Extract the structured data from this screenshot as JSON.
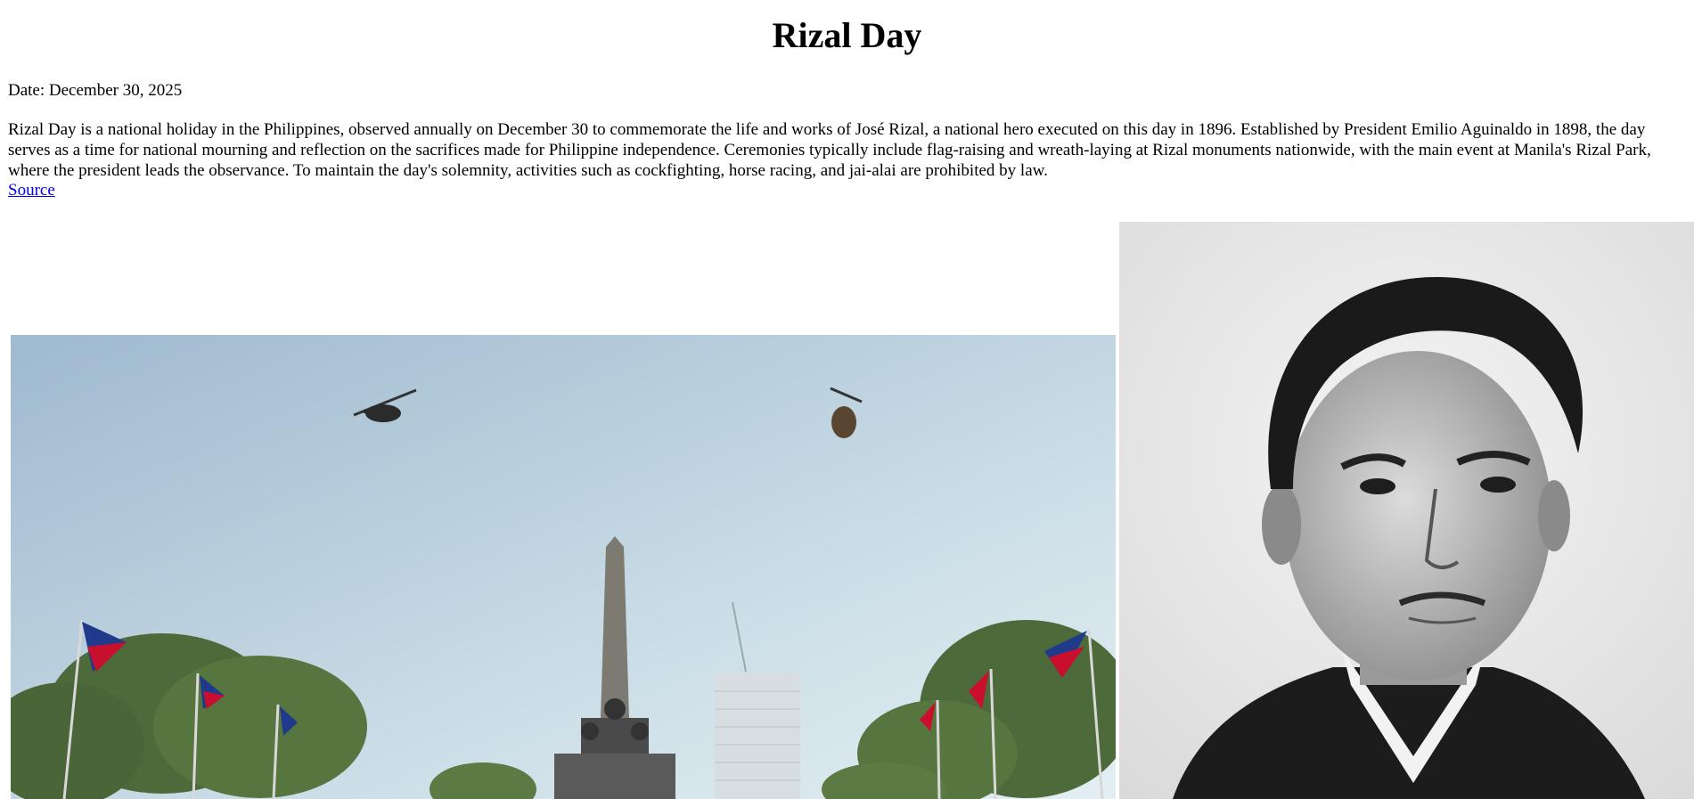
{
  "page": {
    "title": "Rizal Day",
    "date_line": "Date: December 30, 2025",
    "description": "Rizal Day is a national holiday in the Philippines, observed annually on December 30 to commemorate the life and works of José Rizal, a national hero executed on this day in 1896. Established by President Emilio Aguinaldo in 1898, the day serves as a time for national mourning and reflection on the sacrifices made for Philippine independence. Ceremonies typically include flag-raising and wreath-laying at Rizal monuments nationwide, with the main event at Manila's Rizal Park, where the president leads the observance. To maintain the day's solemnity, activities such as cockfighting, horse racing, and jai-alai are prohibited by law.",
    "source_link": "Source"
  },
  "images": {
    "park_photo": {
      "subject": "rizal-monument-photo"
    },
    "portrait_photo": {
      "subject": "jose-rizal-portrait"
    }
  },
  "colors": {
    "link": "#0000ee",
    "sky_top": "#9fb9cf",
    "sky_bottom": "#e4eff2",
    "foliage": "#4c6a3a",
    "flag_blue": "#1f3a8a",
    "flag_red": "#c8102e"
  }
}
